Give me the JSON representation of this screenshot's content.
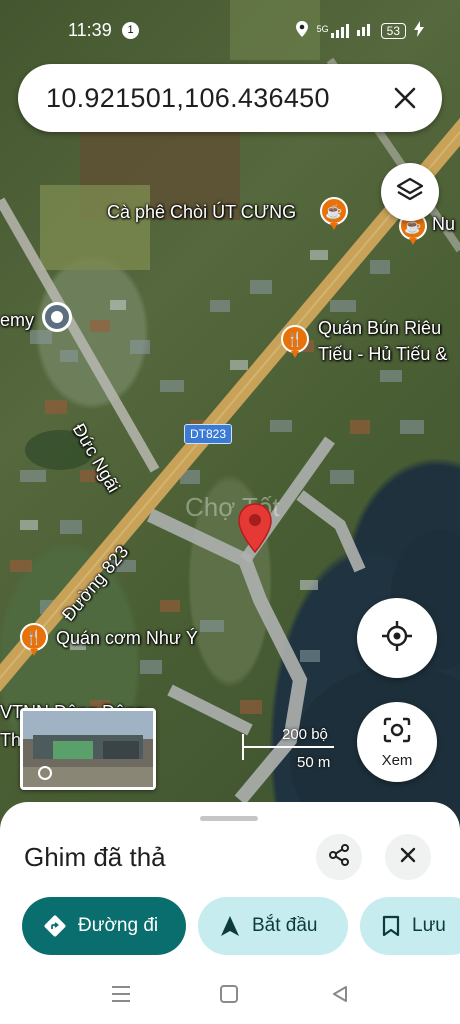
{
  "status_bar": {
    "time": "11:39",
    "notification_count": "1",
    "network": "5G",
    "battery": "53"
  },
  "search": {
    "query": "10.921501,106.436450"
  },
  "map": {
    "labels": {
      "cafe": "Cà phê Chòi ÚT CƯNG",
      "nu": "Nu",
      "emy": "emy",
      "bun_rieu_1": "Quán Bún Riêu",
      "bun_rieu_2": "Tiếu - Hủ Tiếu &",
      "duc_ngai": "Đức Ngãi",
      "duong_823": "Đường 823",
      "com_nhu_y": "Quán cơm Như Ý",
      "partial_1": "VTNN Dông Dông",
      "partial_2": "Th"
    },
    "road_shield": "DT823",
    "watermark": "Chợ Tốt",
    "colors": {
      "pin": "#e53935",
      "poi": "#e8710a",
      "road": "#c9a25a"
    }
  },
  "scale": {
    "imperial": "200 bộ",
    "metric": "50 m"
  },
  "buttons": {
    "lens_label": "Xem"
  },
  "sheet": {
    "title": "Ghim đã thả",
    "actions": {
      "directions": "Đường đi",
      "start": "Bắt đầu",
      "save": "Lưu"
    }
  },
  "icons": [
    "layers-icon",
    "locate-icon",
    "lens-icon",
    "share-icon",
    "close-icon",
    "directions-icon",
    "navigation-icon",
    "bookmark-icon"
  ]
}
